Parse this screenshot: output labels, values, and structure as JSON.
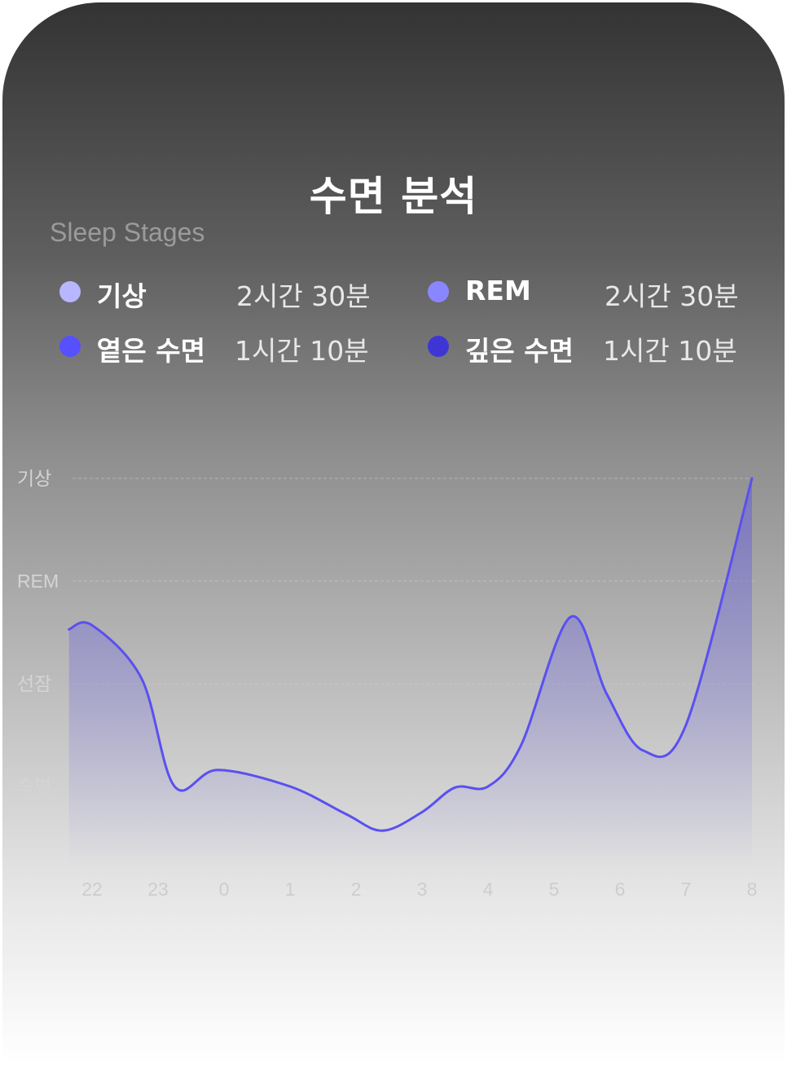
{
  "header": {
    "title": "수면 분석",
    "subtitle": "Sleep Stages"
  },
  "legend": [
    {
      "label": "기상",
      "value": "2시간 30분",
      "color": "#b8b6ff",
      "icon": "dot"
    },
    {
      "label": "REM",
      "value": "2시간 30분",
      "color": "#8a86ff",
      "icon": "dot"
    },
    {
      "label": "옅은 수면",
      "value": "1시간 10분",
      "color": "#5750ff",
      "icon": "dot"
    },
    {
      "label": "깊은 수면",
      "value": "1시간 10분",
      "color": "#3e36d4",
      "icon": "dot"
    }
  ],
  "chart_data": {
    "type": "area",
    "title": "",
    "xlabel": "",
    "ylabel": "",
    "y_categories": [
      "기상",
      "REM",
      "선잠",
      "숙면"
    ],
    "x_ticks": [
      "22",
      "23",
      "0",
      "1",
      "2",
      "3",
      "4",
      "5",
      "6",
      "7",
      "8"
    ],
    "grid": true,
    "line_color": "#5a50f0",
    "series": [
      {
        "values": [
          {
            "x": 21.65,
            "y": 1.53
          },
          {
            "x": 22.0,
            "y": 1.57
          },
          {
            "x": 22.75,
            "y": 1.05
          },
          {
            "x": 23.25,
            "y": 0.0
          },
          {
            "x": 23.9,
            "y": 0.16
          },
          {
            "x": 1.0,
            "y": 0.0
          },
          {
            "x": 1.85,
            "y": -0.27
          },
          {
            "x": 2.4,
            "y": -0.43
          },
          {
            "x": 3.0,
            "y": -0.25
          },
          {
            "x": 3.5,
            "y": -0.01
          },
          {
            "x": 4.0,
            "y": 0.0
          },
          {
            "x": 4.5,
            "y": 0.4
          },
          {
            "x": 5.25,
            "y": 1.65
          },
          {
            "x": 5.8,
            "y": 0.9
          },
          {
            "x": 6.35,
            "y": 0.35
          },
          {
            "x": 7.0,
            "y": 0.6
          },
          {
            "x": 8.0,
            "y": 3.0
          }
        ]
      }
    ]
  }
}
